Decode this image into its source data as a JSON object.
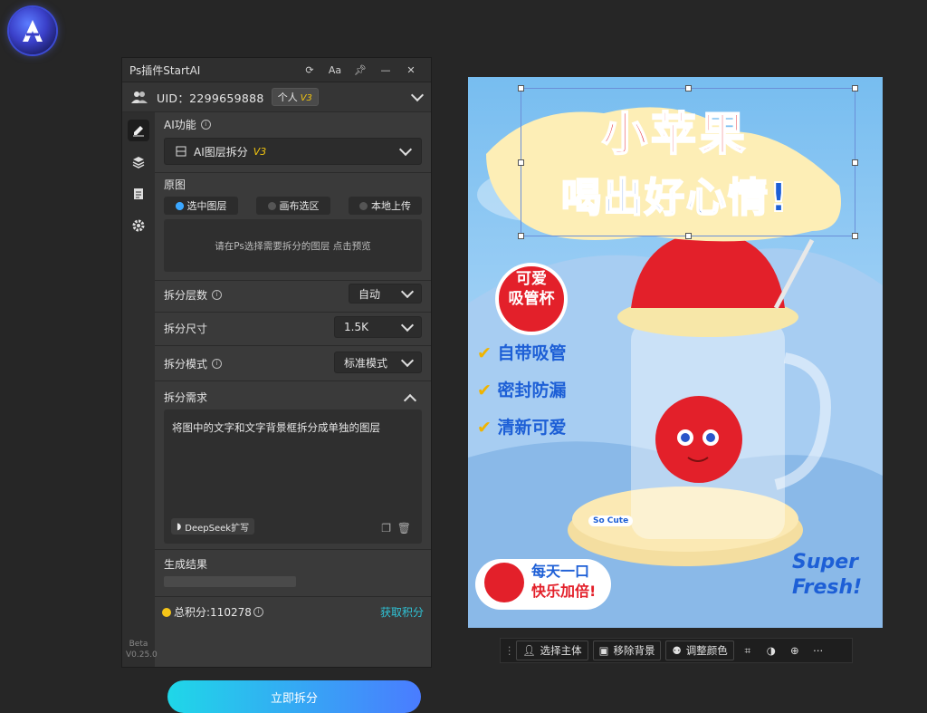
{
  "panel": {
    "title": "Ps插件StartAI",
    "title_buttons": [
      "refresh-icon",
      "font-size-icon",
      "pin-icon",
      "minimize-icon",
      "close-icon"
    ]
  },
  "user": {
    "uid": "UID：2299659888",
    "tier": "个人",
    "tier_version": "V3"
  },
  "ai": {
    "label": "AI功能",
    "selected": "AI图层拆分",
    "selected_version": "V3"
  },
  "source": {
    "label": "原图",
    "options": [
      "选中图层",
      "画布选区",
      "本地上传"
    ],
    "selected_index": 0,
    "placeholder": "请在Ps选择需要拆分的图层 点击预览"
  },
  "settings": {
    "layers_label": "拆分层数",
    "layers_value": "自动",
    "size_label": "拆分尺寸",
    "size_value": "1.5K",
    "mode_label": "拆分模式",
    "mode_value": "标准模式"
  },
  "requirement": {
    "label": "拆分需求",
    "text": "将图中的文字和文字背景框拆分成单独的图层",
    "expand_button": "DeepSeek扩写"
  },
  "result": {
    "label": "生成结果"
  },
  "footer": {
    "points": "总积分:110278",
    "get_points": "获取积分",
    "generate": "立即拆分",
    "beta": "Beta",
    "version": "V0.25.0"
  },
  "poster": {
    "headline1": "小苹果",
    "headline2": "喝出好心情!",
    "badge_line1": "可爱",
    "badge_line2": "吸管杯",
    "features": [
      "自带吸管",
      "密封防漏",
      "清新可爱"
    ],
    "coaster_text": "So Cute",
    "bottom_line1": "每天一口",
    "bottom_line2": "快乐加倍!",
    "slogan1": "Super",
    "slogan2": "Fresh!"
  },
  "bottom_toolbar": {
    "select_subject": "选择主体",
    "remove_bg": "移除背景",
    "adjust_color": "调整颜色"
  },
  "colors": {
    "accent_gradient_start": "#1fd7e8",
    "accent_gradient_end": "#4a7cff",
    "link": "#2fc3d6",
    "version_yellow": "#f1c40f"
  }
}
